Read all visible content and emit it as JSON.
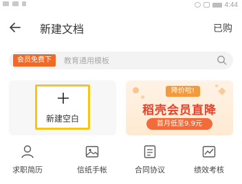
{
  "status_bar": {
    "time": "4:44"
  },
  "header": {
    "back_icon": "back-arrow-icon",
    "title": "新建文档",
    "right_action": "已购"
  },
  "search": {
    "badge": "会员免费下",
    "placeholder": "教育通用模板",
    "icon": "search-icon"
  },
  "new_blank": {
    "label": "新建空白",
    "icon": "plus-icon"
  },
  "banner": {
    "tag": "降价啦!",
    "main": "稻壳会员直降",
    "sub": "首月低至9.9元"
  },
  "categories": [
    {
      "label": "求职简历",
      "icon": "person-icon"
    },
    {
      "label": "信纸手帐",
      "icon": "image-icon"
    },
    {
      "label": "合同协议",
      "icon": "document-icon"
    },
    {
      "label": "绩效考核",
      "icon": "chart-icon"
    }
  ],
  "colors": {
    "accent_orange": "#f06a25",
    "frame_yellow": "#f5c518",
    "banner_red": "#e5422b"
  }
}
